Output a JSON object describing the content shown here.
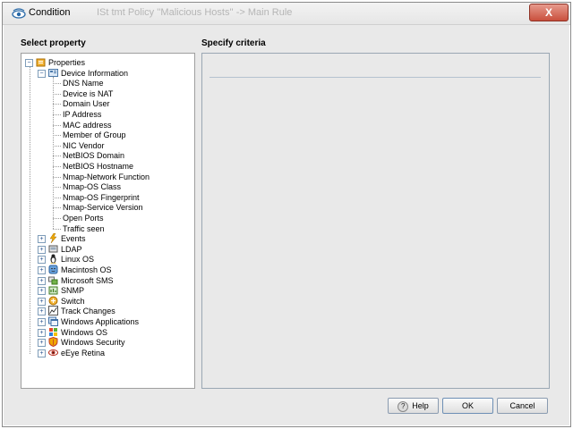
{
  "window": {
    "title": "Condition",
    "background_title": "ISt  tmt  Policy  ''Malicious Hosts''  ->  Main Rule",
    "close_glyph": "X"
  },
  "labels": {
    "select_property": "Select property",
    "specify_criteria": "Specify criteria"
  },
  "tree": {
    "root": "Properties",
    "device_information": "Device Information",
    "device_children": [
      "DNS Name",
      "Device is NAT",
      "Domain User",
      "IP Address",
      "MAC address",
      "Member of Group",
      "NIC Vendor",
      "NetBIOS Domain",
      "NetBIOS Hostname",
      "Nmap-Network Function",
      "Nmap-OS Class",
      "Nmap-OS Fingerprint",
      "Nmap-Service Version",
      "Open Ports",
      "Traffic seen"
    ],
    "categories": [
      {
        "label": "Events",
        "icon": "lightning-icon"
      },
      {
        "label": "LDAP",
        "icon": "ldap-icon"
      },
      {
        "label": "Linux OS",
        "icon": "penguin-icon"
      },
      {
        "label": "Macintosh OS",
        "icon": "mac-icon"
      },
      {
        "label": "Microsoft SMS",
        "icon": "sms-icon"
      },
      {
        "label": "SNMP",
        "icon": "snmp-icon"
      },
      {
        "label": "Switch",
        "icon": "switch-icon"
      },
      {
        "label": "Track Changes",
        "icon": "chart-icon"
      },
      {
        "label": "Windows Applications",
        "icon": "windows-apps-icon"
      },
      {
        "label": "Windows OS",
        "icon": "windows-logo-icon"
      },
      {
        "label": "Windows Security",
        "icon": "shield-icon"
      },
      {
        "label": "eEye Retina",
        "icon": "eye-icon"
      }
    ]
  },
  "buttons": {
    "help": "Help",
    "ok": "OK",
    "cancel": "Cancel"
  },
  "colors": {
    "window_bg": "#e9e9e9",
    "close_button": "#c9503d",
    "expander_border": "#7f9db9"
  }
}
